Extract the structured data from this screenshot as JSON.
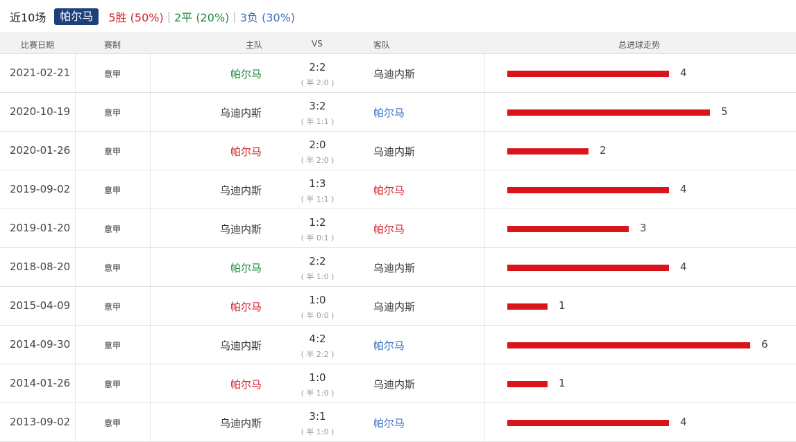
{
  "summary": {
    "count_label": "近10场",
    "team": "帕尔马",
    "wins": "5胜 (50%)",
    "draws": "2平 (20%)",
    "losses": "3负 (30%)",
    "separator": "|"
  },
  "header": {
    "date": "比赛日期",
    "league": "赛制",
    "home": "主队",
    "vs": "VS",
    "away": "客队",
    "trend": "总进球走势"
  },
  "colors": {
    "win": "#d0202a",
    "draw": "#1b8a3a",
    "loss": "#3a6fc4",
    "badge": "#1d3f7a",
    "bar": "#d9141b"
  },
  "matches": [
    {
      "date": "2021-02-21",
      "league": "意甲",
      "home": "帕尔马",
      "score": "2:2",
      "half": "( 半 2:0 )",
      "away": "乌迪内斯",
      "total": 4,
      "home_color": "green",
      "away_color": "dark"
    },
    {
      "date": "2020-10-19",
      "league": "意甲",
      "home": "乌迪内斯",
      "score": "3:2",
      "half": "( 半 1:1 )",
      "away": "帕尔马",
      "total": 5,
      "home_color": "dark",
      "away_color": "blue"
    },
    {
      "date": "2020-01-26",
      "league": "意甲",
      "home": "帕尔马",
      "score": "2:0",
      "half": "( 半 2:0 )",
      "away": "乌迪内斯",
      "total": 2,
      "home_color": "red",
      "away_color": "dark"
    },
    {
      "date": "2019-09-02",
      "league": "意甲",
      "home": "乌迪内斯",
      "score": "1:3",
      "half": "( 半 1:1 )",
      "away": "帕尔马",
      "total": 4,
      "home_color": "dark",
      "away_color": "red"
    },
    {
      "date": "2019-01-20",
      "league": "意甲",
      "home": "乌迪内斯",
      "score": "1:2",
      "half": "( 半 0:1 )",
      "away": "帕尔马",
      "total": 3,
      "home_color": "dark",
      "away_color": "red"
    },
    {
      "date": "2018-08-20",
      "league": "意甲",
      "home": "帕尔马",
      "score": "2:2",
      "half": "( 半 1:0 )",
      "away": "乌迪内斯",
      "total": 4,
      "home_color": "green",
      "away_color": "dark"
    },
    {
      "date": "2015-04-09",
      "league": "意甲",
      "home": "帕尔马",
      "score": "1:0",
      "half": "( 半 0:0 )",
      "away": "乌迪内斯",
      "total": 1,
      "home_color": "red",
      "away_color": "dark"
    },
    {
      "date": "2014-09-30",
      "league": "意甲",
      "home": "乌迪内斯",
      "score": "4:2",
      "half": "( 半 2:2 )",
      "away": "帕尔马",
      "total": 6,
      "home_color": "dark",
      "away_color": "blue"
    },
    {
      "date": "2014-01-26",
      "league": "意甲",
      "home": "帕尔马",
      "score": "1:0",
      "half": "( 半 1:0 )",
      "away": "乌迪内斯",
      "total": 1,
      "home_color": "red",
      "away_color": "dark"
    },
    {
      "date": "2013-09-02",
      "league": "意甲",
      "home": "乌迪内斯",
      "score": "3:1",
      "half": "( 半 1:0 )",
      "away": "帕尔马",
      "total": 4,
      "home_color": "dark",
      "away_color": "blue"
    }
  ]
}
